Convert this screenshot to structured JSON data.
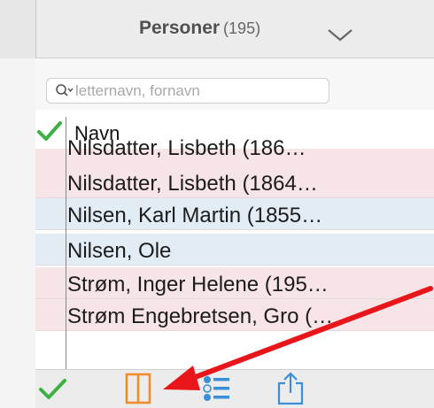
{
  "header": {
    "title": "Personer",
    "count": "(195)"
  },
  "search": {
    "placeholder": "letternavn, fornavn"
  },
  "table": {
    "column_header": "Navn",
    "rows": [
      {
        "name": "Nilsdatter, Lisbeth (186…",
        "color": "pink"
      },
      {
        "name": "Nilsdatter, Lisbeth (1864…",
        "color": "pink"
      },
      {
        "name": "Nilsen, Karl Martin (1855…",
        "color": "blue"
      },
      {
        "name": "Nilsen, Ole",
        "color": "blue"
      },
      {
        "name": "Strøm, Inger Helene (195…",
        "color": "pink"
      },
      {
        "name": "Strøm Engebretsen, Gro (…",
        "color": "pink"
      }
    ]
  },
  "footer": {
    "icons": [
      "checkmark-icon",
      "split-view-icon",
      "list-options-icon",
      "share-icon"
    ]
  },
  "colors": {
    "check_green": "#3cb043",
    "accent_orange": "#f08c2c",
    "accent_blue": "#3a8fd6",
    "annotation_red": "#e8161b",
    "row_pink": "#f7e4e6",
    "row_blue": "#e2ecf5"
  },
  "annotation": "red-arrow-pointing-to-split-view-icon"
}
